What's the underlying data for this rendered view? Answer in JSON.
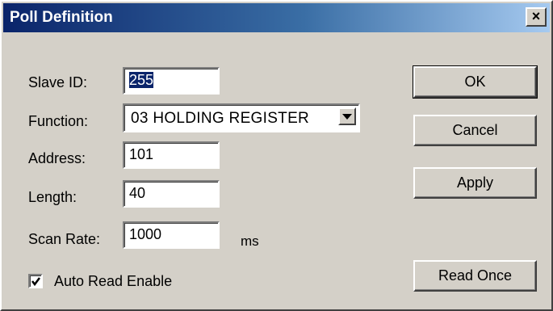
{
  "window": {
    "title": "Poll Definition",
    "close_label": "×"
  },
  "form": {
    "slave_id_label": "Slave ID:",
    "slave_id_value": "255",
    "function_label": "Function:",
    "function_value": "03 HOLDING REGISTER",
    "address_label": "Address:",
    "address_value": "101",
    "length_label": "Length:",
    "length_value": "40",
    "scan_rate_label": "Scan Rate:",
    "scan_rate_value": "1000",
    "scan_rate_unit": "ms",
    "auto_read_label": "Auto Read Enable",
    "auto_read_checked": true
  },
  "buttons": {
    "ok": "OK",
    "cancel": "Cancel",
    "apply": "Apply",
    "read_once": "Read Once"
  },
  "icons": {
    "close": "close-icon",
    "dropdown": "chevron-down-icon",
    "check": "check-icon"
  },
  "colors": {
    "dialog_bg": "#d4d0c8",
    "title_start": "#0a246a",
    "title_end": "#a6caf0",
    "selection": "#0a246a"
  }
}
